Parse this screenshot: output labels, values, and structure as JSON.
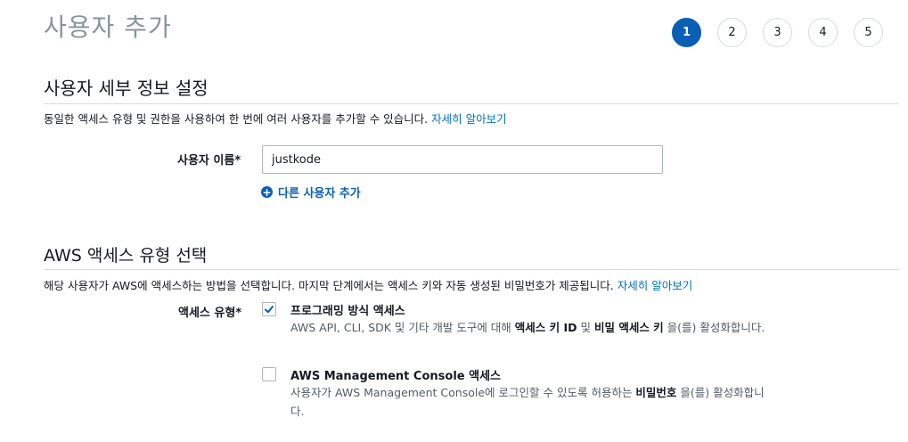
{
  "page_title": "사용자 추가",
  "steps": [
    {
      "label": "1",
      "active": true
    },
    {
      "label": "2",
      "active": false
    },
    {
      "label": "3",
      "active": false
    },
    {
      "label": "4",
      "active": false
    },
    {
      "label": "5",
      "active": false
    }
  ],
  "user_details": {
    "title": "사용자 세부 정보 설정",
    "description": "동일한 액세스 유형 및 권한을 사용하여 한 번에 여러 사용자를 추가할 수 있습니다.",
    "learn_more": "자세히 알아보기",
    "username_label": "사용자 이름*",
    "username_value": "justkode",
    "add_user_label": "다른 사용자 추가"
  },
  "access_type": {
    "title": "AWS 액세스 유형 선택",
    "description": "해당 사용자가 AWS에 액세스하는 방법을 선택합니다. 마지막 단계에서는 액세스 키와 자동 생성된 비밀번호가 제공됩니다.",
    "learn_more": "자세히 알아보기",
    "label": "액세스 유형*",
    "options": [
      {
        "checked": true,
        "title": "프로그래밍 방식 액세스",
        "desc_pre": "AWS API, CLI, SDK 및 기타 개발 도구에 대해 ",
        "desc_b1": "액세스 키 ID",
        "desc_mid": " 및 ",
        "desc_b2": "비밀 액세스 키",
        "desc_post": " 을(를) 활성화합니다."
      },
      {
        "checked": false,
        "title": "AWS Management Console 액세스",
        "desc_pre": "사용자가 AWS Management Console에 로그인할 수 있도록 허용하는 ",
        "desc_b1": "비밀번호",
        "desc_post": " 을(를) 활성화합니다."
      }
    ]
  },
  "colors": {
    "accent": "#0a5fb4",
    "link": "#0073bb",
    "muted_title": "#879596"
  }
}
